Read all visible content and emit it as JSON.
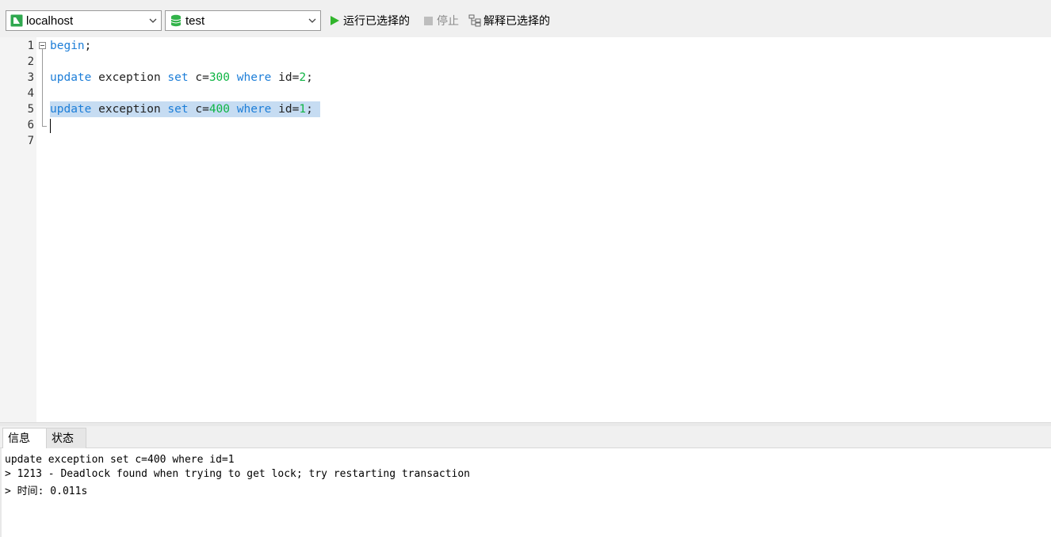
{
  "toolbar": {
    "connection": "localhost",
    "database": "test",
    "run_selected_label": "运行已选择的",
    "stop_label": "停止",
    "explain_selected_label": "解释已选择的",
    "colors": {
      "run": "#31b52c",
      "stop": "#bdbdbd",
      "connection_icon": "#2fa84f",
      "database_icon": "#32b34a"
    }
  },
  "editor": {
    "line_numbers": [
      "1",
      "2",
      "3",
      "4",
      "5",
      "6",
      "7"
    ],
    "line1": {
      "kw": "begin",
      "rest": ";"
    },
    "line3": {
      "t1": "update",
      "t2": " exception ",
      "t3": "set",
      "t4": " c=",
      "t5": "300",
      "t6": " ",
      "t7": "where",
      "t8": " id=",
      "t9": "2",
      "t10": ";"
    },
    "line5": {
      "t1": "update",
      "t2": " exception ",
      "t3": "set",
      "t4": " c=",
      "t5": "400",
      "t6": " ",
      "t7": "where",
      "t8": " id=",
      "t9": "1",
      "t10": "; "
    }
  },
  "result_tabs": {
    "info": "信息",
    "status": "状态"
  },
  "messages": [
    "update exception set c=400 where id=1",
    "> 1213 - Deadlock found when trying to get lock; try restarting transaction",
    "> 时间: 0.011s"
  ]
}
